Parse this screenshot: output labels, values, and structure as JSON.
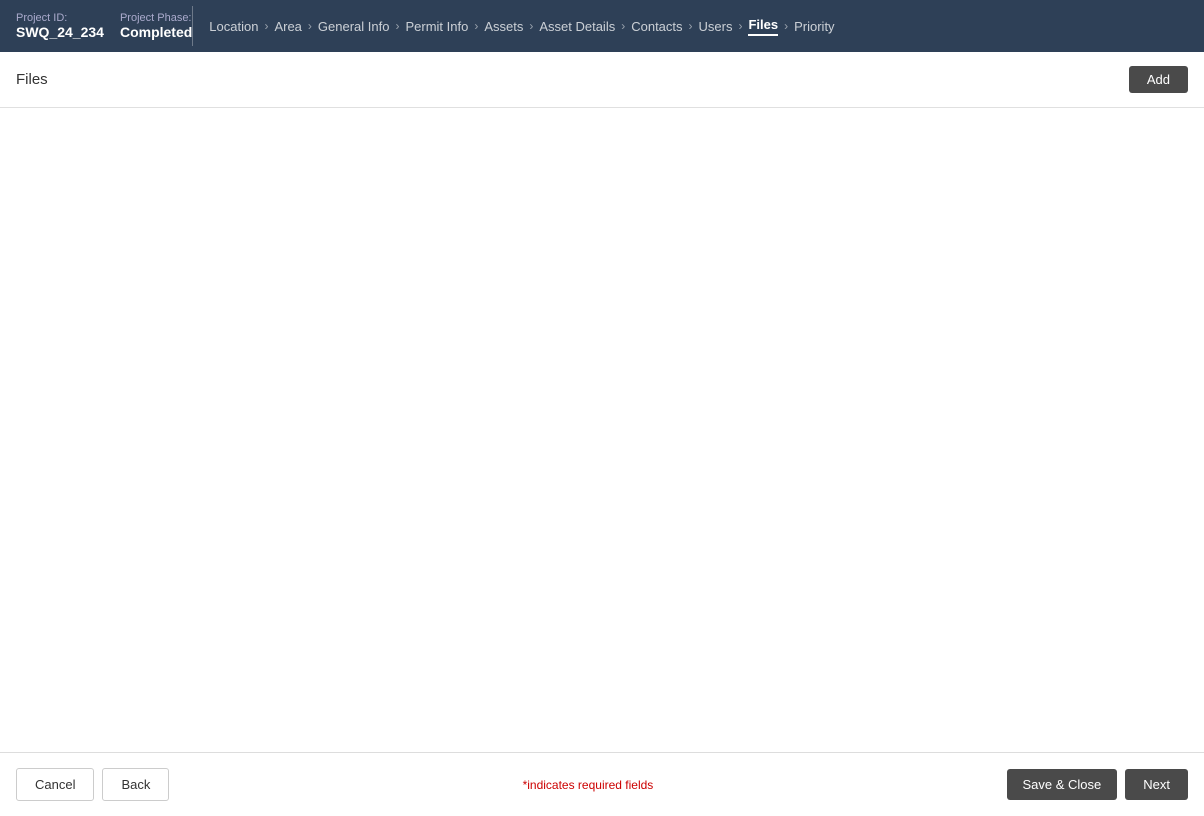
{
  "header": {
    "project_id_label": "Project ID:",
    "project_id_value": "SWQ_24_234",
    "project_phase_label": "Project Phase:",
    "project_phase_value": "Completed"
  },
  "breadcrumb": {
    "items": [
      {
        "label": "Location",
        "active": false
      },
      {
        "label": "Area",
        "active": false
      },
      {
        "label": "General Info",
        "active": false
      },
      {
        "label": "Permit Info",
        "active": false
      },
      {
        "label": "Assets",
        "active": false
      },
      {
        "label": "Asset Details",
        "active": false
      },
      {
        "label": "Contacts",
        "active": false
      },
      {
        "label": "Users",
        "active": false
      },
      {
        "label": "Files",
        "active": true
      },
      {
        "label": "Priority",
        "active": false
      }
    ]
  },
  "files_panel": {
    "title": "Files",
    "add_button_label": "Add"
  },
  "footer": {
    "cancel_label": "Cancel",
    "back_label": "Back",
    "required_text": "indicates required fields",
    "save_close_label": "Save & Close",
    "next_label": "Next"
  }
}
